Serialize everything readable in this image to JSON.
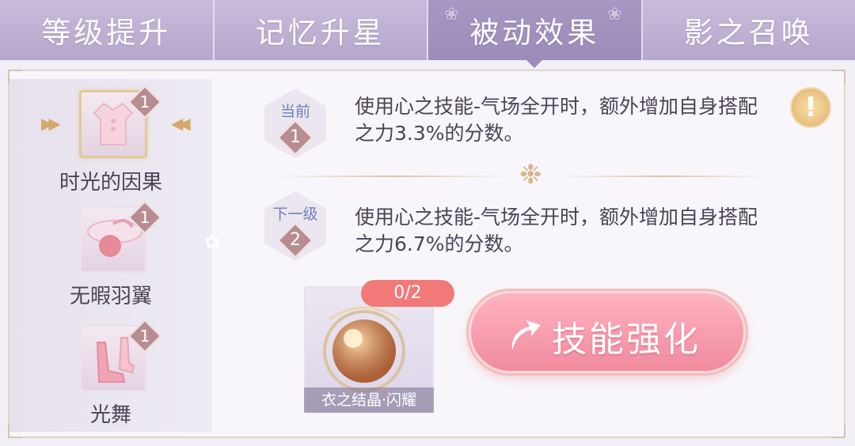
{
  "tabs": [
    {
      "label": "等级提升"
    },
    {
      "label": "记忆升星"
    },
    {
      "label": "被动效果"
    },
    {
      "label": "影之召唤"
    }
  ],
  "active_tab": "被动效果",
  "sidebar": {
    "items": [
      {
        "label": "时光的因果",
        "badge": "1"
      },
      {
        "label": "无暇羽翼",
        "badge": "1"
      },
      {
        "label": "光舞",
        "badge": "1"
      }
    ]
  },
  "current": {
    "label": "当前",
    "level": "1",
    "desc": "使用心之技能-气场全开时，额外增加自身搭配之力3.3%的分数。"
  },
  "next": {
    "label": "下一级",
    "level": "2",
    "desc": "使用心之技能-气场全开时，额外增加自身搭配之力6.7%的分数。"
  },
  "material": {
    "count": "0/2",
    "name": "衣之结晶·闪耀"
  },
  "button": {
    "label": "技能强化"
  },
  "warning_symbol": "!",
  "colors": {
    "tab_active": "#9c8cba",
    "button": "#f08a9f",
    "badge": "#b78d91",
    "count_pill": "#f17a79"
  }
}
